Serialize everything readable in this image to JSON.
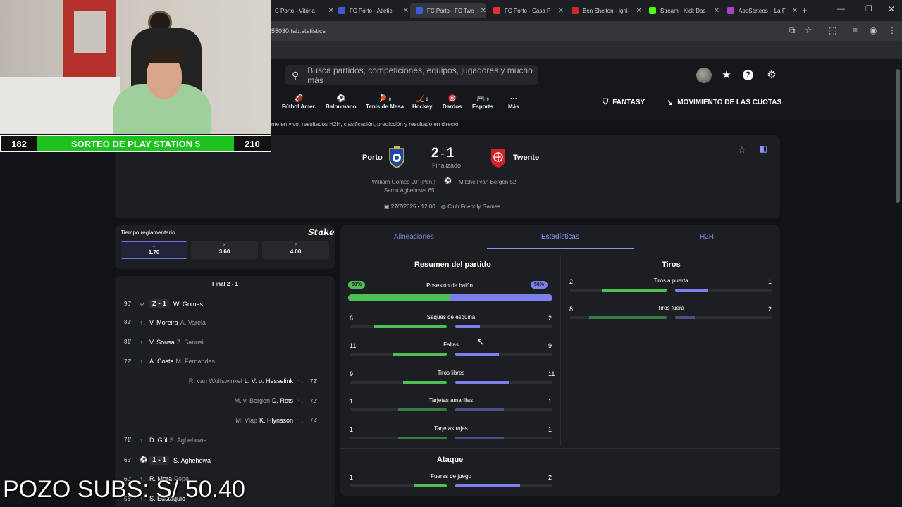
{
  "browser": {
    "tabs": [
      {
        "title": "C Porto - Vitória",
        "color": "#2c2c2c",
        "active": false
      },
      {
        "title": "FC Porto - Atlétic",
        "color": "#3b5bdb",
        "active": false
      },
      {
        "title": "FC Porto - FC Twe",
        "color": "#3b5bdb",
        "active": true
      },
      {
        "title": "FC Porto - Casa P",
        "color": "#e03131",
        "active": false
      },
      {
        "title": "Ben Shelton - Igni",
        "color": "#c92a2a",
        "active": false
      },
      {
        "title": "Stream - Kick Das",
        "color": "#53fc18",
        "active": false
      },
      {
        "title": "AppSorteos – La F",
        "color": "#ae3ec9",
        "active": false
      }
    ],
    "url": "55030.tab:statistics",
    "new_tab": "+"
  },
  "header": {
    "search_placeholder": "Busca partidos, competiciones, equipos, jugadores y mucho más",
    "sports": [
      {
        "label": "Fútbol Amer.",
        "icon": "🏈",
        "count": ""
      },
      {
        "label": "Balonmano",
        "icon": "⚽",
        "count": ""
      },
      {
        "label": "Tenis de Mesa",
        "icon": "🏓",
        "count": "8"
      },
      {
        "label": "Hockey",
        "icon": "🏒",
        "count": "2"
      },
      {
        "label": "Dardos",
        "icon": "🎯",
        "count": ""
      },
      {
        "label": "Esports",
        "icon": "🎮",
        "count": "9"
      },
      {
        "label": "Más",
        "icon": "⋯",
        "count": ""
      }
    ],
    "fantasy": "FANTASY",
    "odds_movement": "MOVIMIENTO DE LAS CUOTAS",
    "subline": "nte en vivo, resultados H2H, clasificación, predicción y resultado en directo"
  },
  "match": {
    "home": "Porto",
    "away": "Twente",
    "home_score": "2",
    "away_score": "1",
    "status": "Finalizado",
    "home_scorers": [
      "William Gomes 90' (Pen.)",
      "Samu Aghehowa 65'"
    ],
    "away_scorers": [
      "Mitchell van Bergen 52'"
    ],
    "date": "27/7/2025 • 12:00",
    "competition": "Club Friendly Games"
  },
  "odds": {
    "title": "Tiempo reglamentario",
    "brand": "Stake",
    "items": [
      {
        "label": "1",
        "value": "1.70"
      },
      {
        "label": "X",
        "value": "3.60"
      },
      {
        "label": "2",
        "value": "4.00"
      }
    ]
  },
  "events": {
    "header": "Final 2 - 1",
    "items": [
      {
        "min": "90'",
        "type": "penalty",
        "score": "2 - 1",
        "player": "W. Gomes",
        "sub": "",
        "side": "home"
      },
      {
        "min": "82'",
        "type": "sub",
        "score": "",
        "player": "V. Moreira",
        "sub": "A. Varela",
        "side": "home"
      },
      {
        "min": "81'",
        "type": "sub",
        "score": "",
        "player": "V. Sousa",
        "sub": "Z. Sanusi",
        "side": "home"
      },
      {
        "min": "72'",
        "type": "sub",
        "score": "",
        "player": "A. Costa",
        "sub": "M. Fernandes",
        "side": "home"
      },
      {
        "min": "72'",
        "type": "sub",
        "score": "",
        "player": "L. V. o. Hesselink",
        "sub": "R. van Wolfswinkel",
        "side": "away"
      },
      {
        "min": "72'",
        "type": "sub",
        "score": "",
        "player": "D. Rots",
        "sub": "M. v. Bergen",
        "side": "away"
      },
      {
        "min": "72'",
        "type": "sub",
        "score": "",
        "player": "K. Hlynsson",
        "sub": "M. Vlap",
        "side": "away"
      },
      {
        "min": "71'",
        "type": "sub",
        "score": "",
        "player": "D. Gül",
        "sub": "S. Aghehowa",
        "side": "home"
      },
      {
        "min": "65'",
        "type": "goal",
        "score": "1 - 1",
        "player": "S. Aghehowa",
        "sub": "",
        "side": "home"
      },
      {
        "min": "60'",
        "type": "sub",
        "score": "",
        "player": "R. Mora",
        "sub": "Pepê",
        "side": "home"
      },
      {
        "min": "56'",
        "type": "sub",
        "score": "",
        "player": "S. Eustáquio",
        "sub": "",
        "side": "home"
      }
    ]
  },
  "stats": {
    "tabs": [
      "Alineaciones",
      "Estadísticas",
      "H2H"
    ],
    "summary_title": "Resumen del partido",
    "possession": {
      "label": "Posesión de balón",
      "home": "50%",
      "away": "50%",
      "home_pct": 50
    },
    "summary": [
      {
        "label": "Saques de esquina",
        "home": "6",
        "away": "2",
        "home_frac": 0.75,
        "away_frac": 0.25
      },
      {
        "label": "Faltas",
        "home": "11",
        "away": "9",
        "home_frac": 0.55,
        "away_frac": 0.45
      },
      {
        "label": "Tiros libres",
        "home": "9",
        "away": "11",
        "home_frac": 0.45,
        "away_frac": 0.55
      },
      {
        "label": "Tarjetas amarillas",
        "home": "1",
        "away": "1",
        "home_frac": 0.5,
        "away_frac": 0.5
      },
      {
        "label": "Tarjetas rojas",
        "home": "1",
        "away": "1",
        "home_frac": 0.5,
        "away_frac": 0.5
      }
    ],
    "shots_title": "Tiros",
    "shots": [
      {
        "label": "Tiros a puerta",
        "home": "2",
        "away": "1",
        "home_frac": 0.67,
        "away_frac": 0.33
      },
      {
        "label": "Tiros fuera",
        "home": "8",
        "away": "2",
        "home_frac": 0.8,
        "away_frac": 0.2
      }
    ],
    "attack_title": "Ataque",
    "attack": [
      {
        "label": "Fueras de juego",
        "home": "1",
        "away": "2",
        "home_frac": 0.33,
        "away_frac": 0.67
      }
    ]
  },
  "overlay": {
    "counter_left": "182",
    "banner": "SORTEO DE PLAY STATION 5",
    "counter_right": "210",
    "pozo": "POZO SUBS: S/ 50.40"
  },
  "colors": {
    "home": "#4cbf55",
    "away": "#7c80ec",
    "accent": "#8d95f5"
  }
}
